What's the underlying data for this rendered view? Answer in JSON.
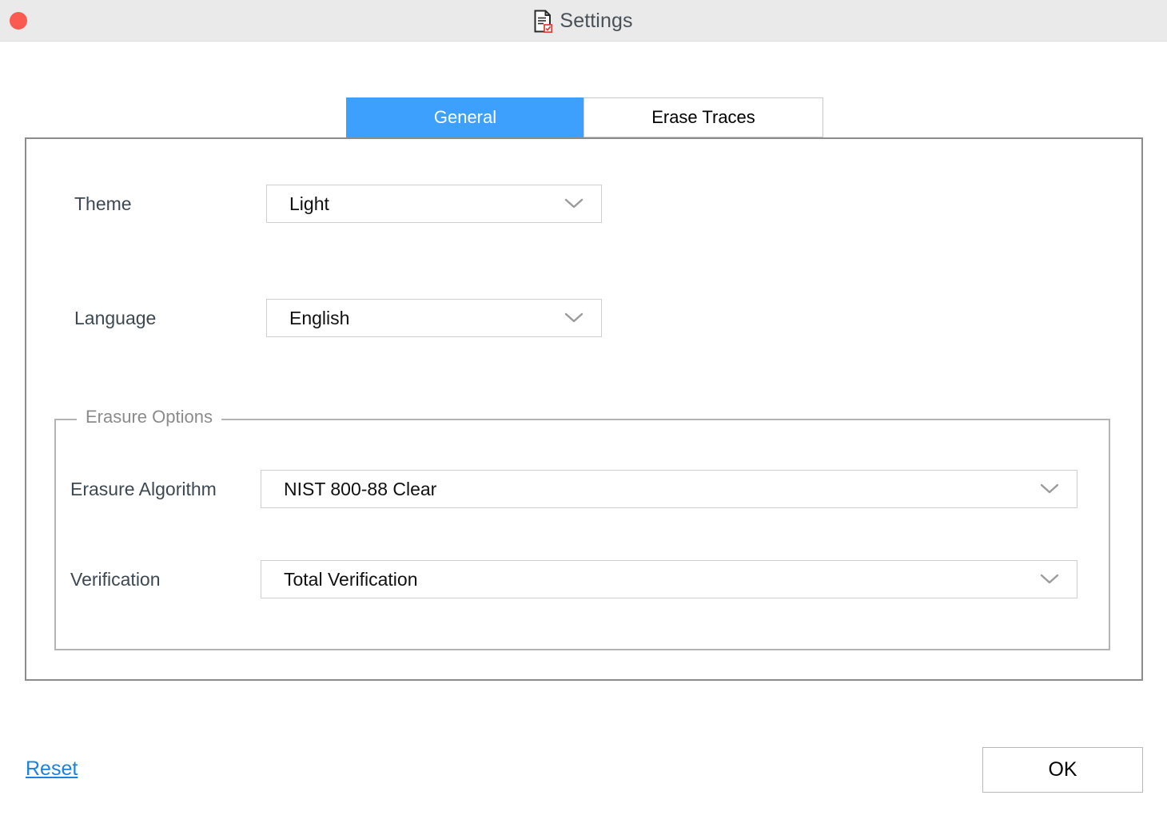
{
  "window": {
    "title": "Settings",
    "title_icon": "document-check-icon",
    "close_button_icon": "close-circle-icon",
    "titlebar_color": "#eaeaea",
    "accent_color": "#3da0fc",
    "link_color": "#1a82e2",
    "close_button_color": "#fa5a50"
  },
  "tabs": [
    {
      "id": "general",
      "label": "General",
      "active": true
    },
    {
      "id": "erase-traces",
      "label": "Erase Traces",
      "active": false
    }
  ],
  "general": {
    "theme": {
      "label": "Theme",
      "value": "Light",
      "chevron_icon": "chevron-down-icon"
    },
    "language": {
      "label": "Language",
      "value": "English",
      "chevron_icon": "chevron-down-icon"
    },
    "erasure_options": {
      "legend": "Erasure Options",
      "algorithm": {
        "label": "Erasure Algorithm",
        "value": "NIST 800-88 Clear",
        "chevron_icon": "chevron-down-icon"
      },
      "verification": {
        "label": "Verification",
        "value": "Total Verification",
        "chevron_icon": "chevron-down-icon"
      }
    }
  },
  "footer": {
    "reset_label": "Reset",
    "ok_label": "OK"
  }
}
